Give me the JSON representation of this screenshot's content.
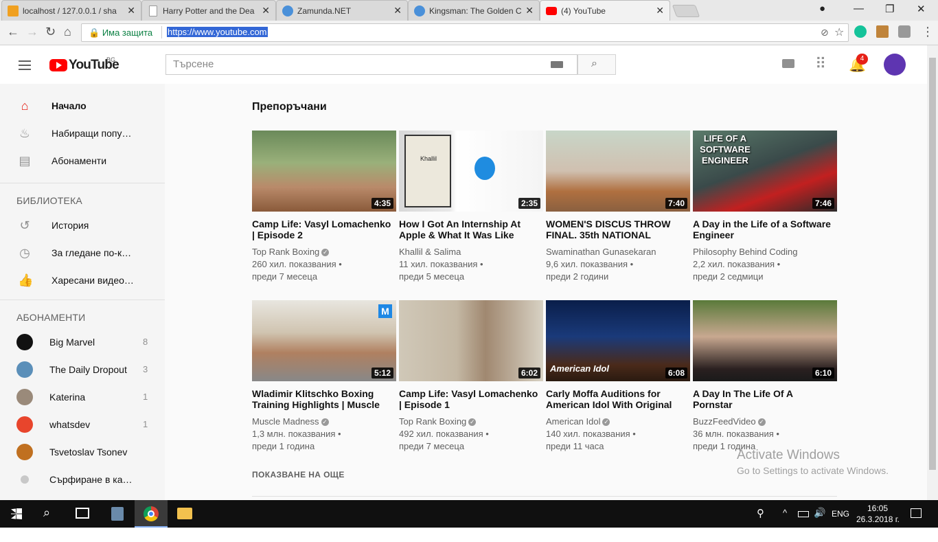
{
  "browser": {
    "tabs": [
      {
        "title": "localhost / 127.0.0.1 / sha",
        "favicon": "phpmyadmin-icon"
      },
      {
        "title": "Harry Potter and the Dea",
        "favicon": "page-icon"
      },
      {
        "title": "Zamunda.NET",
        "favicon": "globe-icon"
      },
      {
        "title": "Kingsman: The Golden C",
        "favicon": "globe-icon"
      },
      {
        "title": "(4) YouTube",
        "favicon": "youtube-icon"
      }
    ],
    "security_label": "Има защита",
    "url": "https://www.youtube.com"
  },
  "youtube": {
    "logo_text": "YouTube",
    "region": "BG",
    "search_placeholder": "Търсене",
    "notifications_count": "4",
    "sidebar": {
      "main_items": [
        {
          "label": "Начало",
          "icon": "home-icon"
        },
        {
          "label": "Набиращи попу…",
          "icon": "fire-icon"
        },
        {
          "label": "Абонаменти",
          "icon": "subscriptions-icon"
        }
      ],
      "library_heading": "БИБЛИОТЕКА",
      "library_items": [
        {
          "label": "История",
          "icon": "history-icon"
        },
        {
          "label": "За гледане по-к…",
          "icon": "clock-icon"
        },
        {
          "label": "Харесани видео…",
          "icon": "thumbs-up-icon"
        }
      ],
      "subs_heading": "АБОНАМЕНТИ",
      "subscriptions": [
        {
          "name": "Big Marvel",
          "count": "8"
        },
        {
          "name": "The Daily Dropout",
          "count": "3"
        },
        {
          "name": "Katerina",
          "count": "1"
        },
        {
          "name": "whatsdev",
          "count": "1"
        },
        {
          "name": "Tsvetoslav Tsonev",
          "count": ""
        },
        {
          "name": "Сърфиране в ка…",
          "count": ""
        }
      ]
    },
    "section_title": "Препоръчани",
    "videos": [
      {
        "title": "Camp Life: Vasyl Lomachenko | Episode 2",
        "channel": "Top Rank Boxing",
        "views": "260 хил. показвания •",
        "age": "преди 7 месеца",
        "duration": "4:35"
      },
      {
        "title": "How I Got An Internship At Apple & What It Was Like",
        "channel": "Khallil & Salima",
        "views": "11 хил. показвания •",
        "age": "преди 5 месеца",
        "duration": "2:35"
      },
      {
        "title": "WOMEN'S DISCUS THROW FINAL. 35th NATIONAL",
        "channel": "Swaminathan Gunasekaran",
        "views": "9,6 хил. показвания •",
        "age": "преди 2 години",
        "duration": "7:40"
      },
      {
        "title": "A Day in the Life of a Software Engineer",
        "channel": "Philosophy Behind Coding",
        "views": "2,2 хил. показвания •",
        "age": "преди 2 седмици",
        "duration": "7:46"
      },
      {
        "title": "Wladimir Klitschko Boxing Training Highlights | Muscle",
        "channel": "Muscle Madness",
        "views": "1,3 млн. показвания •",
        "age": "преди 1 година",
        "duration": "5:12"
      },
      {
        "title": "Camp Life: Vasyl Lomachenko | Episode 1",
        "channel": "Top Rank Boxing",
        "views": "492 хил. показвания •",
        "age": "преди 7 месеца",
        "duration": "6:02"
      },
      {
        "title": "Carly Moffa Auditions for American Idol With Original",
        "channel": "American Idol",
        "views": "140 хил. показвания •",
        "age": "преди 11 часа",
        "duration": "6:08"
      },
      {
        "title": "A Day In The Life Of A Pornstar",
        "channel": "BuzzFeedVideo",
        "views": "36 млн. показвания •",
        "age": "преди 1 година",
        "duration": "6:10"
      }
    ],
    "thumb_texts": {
      "software_engineer": "LIFE OF A SOFTWARE ENGINEER",
      "khallil": "Khallil",
      "american_idol": "American Idol"
    },
    "show_more": "ПОКАЗВАНЕ НА ОЩЕ"
  },
  "watermark": {
    "line1": "Activate Windows",
    "line2": "Go to Settings to activate Windows."
  },
  "taskbar": {
    "lang": "ENG",
    "time": "16:05",
    "date": "26.3.2018 г."
  },
  "colors": {
    "youtube_red": "#ff0000",
    "avatar_purple": "#5e35b1",
    "secure_green": "#0b8043"
  }
}
